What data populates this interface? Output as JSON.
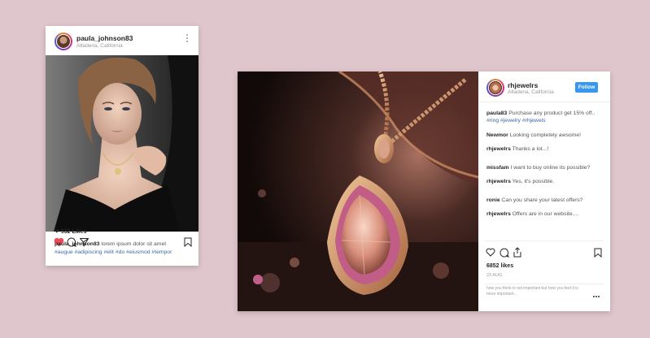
{
  "post1": {
    "username": "paula_johnson83",
    "location": "Altadena, California",
    "likes": "532 Likes",
    "caption_user": "paula_johnson83",
    "caption_text": " lorem ipsum dolor sit amet",
    "hashtags": "#augue  #adipiscing #elit #do #eiusmod #tempor"
  },
  "post2": {
    "username": "rhjewelrs",
    "location": "Altadena, California",
    "follow_label": "Follow",
    "caption_user": "paula83",
    "caption_text": " Purchase any product get 15% off..",
    "caption_tags": "#ring  #jewelry  #rhjewels",
    "comments": [
      {
        "user": "Newmor",
        "text": " Looking completely awsome!"
      },
      {
        "user": "rhjewelrs",
        "text": " Thanks a lot...!"
      },
      {
        "user": "missfam",
        "text": " I want to buy online its possible?"
      },
      {
        "user": "rhjewelrs",
        "text": " Yes, it's possible."
      },
      {
        "user": "ronie",
        "text": " Can you share your latest offers?"
      },
      {
        "user": "rhjewelrs",
        "text": " Offers are in our website...."
      }
    ],
    "likes": "6852 likes",
    "date": "23 AUG",
    "comment_placeholder": "how you think is not important but how you feel it is more important..."
  },
  "colors": {
    "background": "#dec6cc",
    "like_red": "#ed4956",
    "follow_blue": "#3897f0",
    "hashtag_blue": "#3a6aa6"
  },
  "icons": [
    "heart-icon",
    "comment-icon",
    "share-icon",
    "bookmark-icon",
    "more-icon"
  ]
}
